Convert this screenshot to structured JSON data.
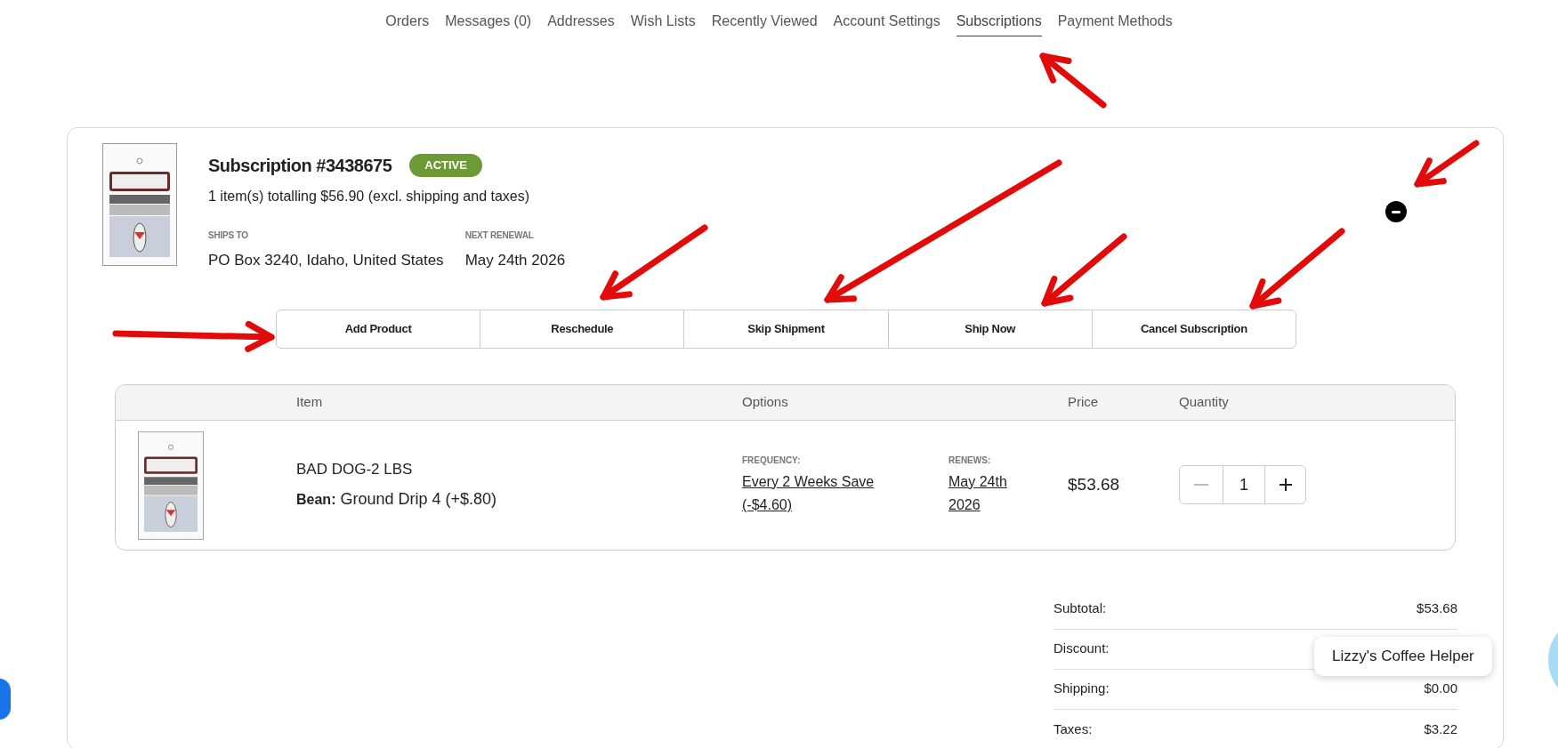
{
  "nav": [
    {
      "label": "Orders",
      "selected": false
    },
    {
      "label": "Messages (0)",
      "selected": false
    },
    {
      "label": "Addresses",
      "selected": false
    },
    {
      "label": "Wish Lists",
      "selected": false
    },
    {
      "label": "Recently Viewed",
      "selected": false
    },
    {
      "label": "Account Settings",
      "selected": false
    },
    {
      "label": "Subscriptions",
      "selected": true
    },
    {
      "label": "Payment Methods",
      "selected": false
    }
  ],
  "subscription": {
    "title": "Subscription #3438675",
    "status": "ACTIVE",
    "summary": "1 item(s) totalling $56.90 (excl. shipping and taxes)",
    "details": [
      {
        "label": "SHIPS TO",
        "value": "PO Box 3240, Idaho, United States"
      },
      {
        "label": "NEXT RENEWAL",
        "value": "May 24th 2026"
      }
    ],
    "actions": [
      "Add Product",
      "Reschedule",
      "Skip Shipment",
      "Ship Now",
      "Cancel Subscription"
    ]
  },
  "items_table": {
    "columns": [
      "Item",
      "Options",
      "Price",
      "Quantity"
    ],
    "rows": [
      {
        "name": "BAD DOG-2 LBS",
        "option": "**Bean:** Ground Drip 4 (+$.80)",
        "frequency_label": "FREQUENCY:",
        "frequency": "Every 2 Weeks Save (-$4.60)",
        "renews_label": "RENEWS:",
        "renews": "May 24th 2026",
        "price": "$53.68",
        "quantity": "1",
        "decrement_disabled": true
      }
    ]
  },
  "totals": [
    {
      "label": "Subtotal:",
      "value": "$53.68"
    },
    {
      "label": "Discount:"
    },
    {
      "label": "Shipping:",
      "value": "$0.00"
    },
    {
      "label": "Taxes:",
      "value": "$3.22"
    }
  ],
  "chat": {
    "label": "Lizzy's Coffee Helper"
  }
}
